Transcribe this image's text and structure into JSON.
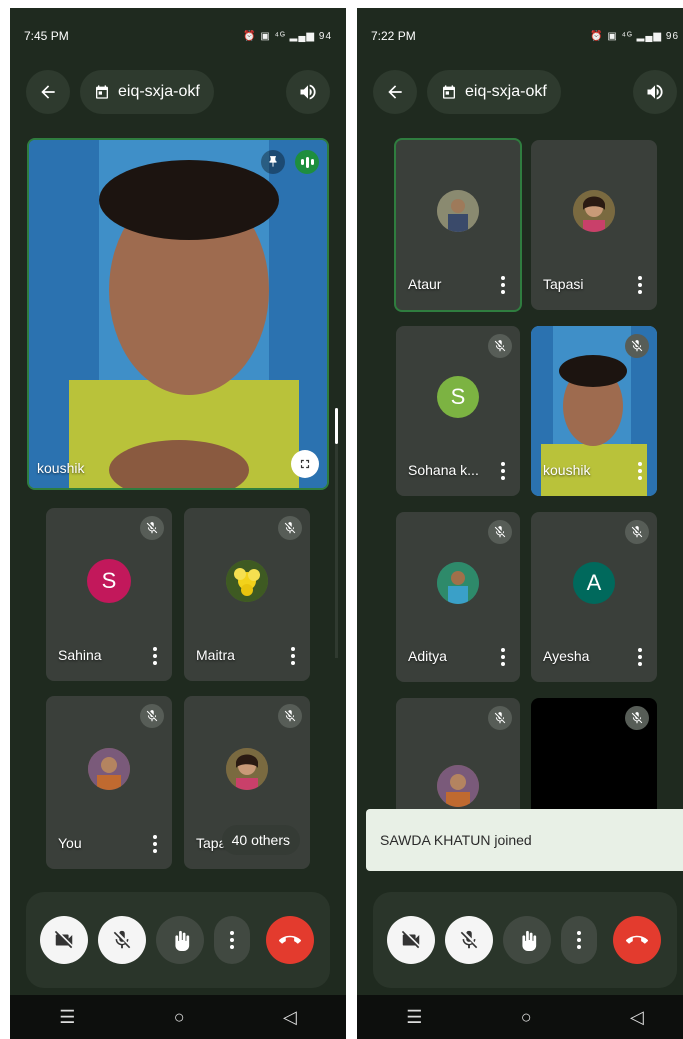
{
  "left": {
    "status": {
      "time": "7:45 PM",
      "icons": "⏰ ▣ ⁴ᴳ ▂▄▆ 94"
    },
    "meeting_code": "eiq-sxja-okf",
    "featured": {
      "name": "koushik"
    },
    "tiles": [
      {
        "name": "Sahina",
        "initial": "S",
        "color": "#c2185b"
      },
      {
        "name": "Maitra",
        "initial": "",
        "color": "#5b7a2a"
      },
      {
        "name": "You",
        "initial": "",
        "color": "#8a6a4a"
      },
      {
        "name": "Tapasi",
        "initial": "",
        "color": "#6d5a4f"
      }
    ],
    "others_label": "40 others"
  },
  "right": {
    "status": {
      "time": "7:22 PM",
      "icons": "⏰ ▣ ⁴ᴳ ▂▄▆ 96"
    },
    "meeting_code": "eiq-sxja-okf",
    "tiles": [
      {
        "name": "Ataur",
        "initial": "",
        "color": "#6f6a5a"
      },
      {
        "name": "Tapasi",
        "initial": "",
        "color": "#6d5a4f"
      },
      {
        "name": "Sohana k...",
        "initial": "S",
        "color": "#7cb342"
      },
      {
        "name": "koushik",
        "initial": "",
        "color": "#4a6a2a"
      },
      {
        "name": "Aditya",
        "initial": "",
        "color": "#3b6f7a"
      },
      {
        "name": "Ayesha",
        "initial": "A",
        "color": "#00695c"
      }
    ],
    "toast": "SAWDA KHATUN joined"
  },
  "colors": {
    "background": "#1f2a1f",
    "accent": "#2f7d3f",
    "end_call": "#e33b2e"
  },
  "icons": [
    "back-arrow-icon",
    "calendar-icon",
    "speaker-icon",
    "pin-icon",
    "mic-off-icon",
    "more-vert-icon",
    "camera-off-icon",
    "hand-icon",
    "end-call-icon",
    "fullscreen-icon"
  ]
}
